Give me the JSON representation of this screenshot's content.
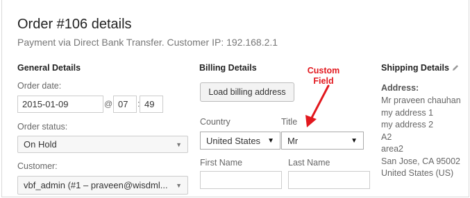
{
  "title": "Order #106 details",
  "subtitle": "Payment via Direct Bank Transfer. Customer IP: 192.168.2.1",
  "general": {
    "heading": "General Details",
    "order_date_label": "Order date:",
    "date_value": "2015-01-09",
    "at_sign": "@",
    "hour": "07",
    "colon": ":",
    "minute": "49",
    "status_label": "Order status:",
    "status_value": "On Hold",
    "customer_label": "Customer:",
    "customer_value": "vbf_admin (#1 – praveen@wisdml..."
  },
  "billing": {
    "heading": "Billing Details",
    "load_button": "Load billing address",
    "country_label": "Country",
    "country_value": "United States",
    "title_label": "Title",
    "title_value": "Mr",
    "first_name_label": "First Name",
    "first_name_value": "",
    "last_name_label": "Last Name",
    "last_name_value": ""
  },
  "annotation": {
    "line1": "Custom",
    "line2": "Field",
    "color": "#e2181e"
  },
  "shipping": {
    "heading": "Shipping Details",
    "address_label": "Address:",
    "lines": [
      "Mr praveen chauhan",
      "my address 1",
      "my address 2",
      "A2",
      "area2",
      "San Jose, CA 95002",
      "United States (US)"
    ]
  },
  "icons": {
    "edit": "pencil-icon",
    "dropdown": "chevron-down-icon",
    "arrow": "arrow-icon"
  }
}
